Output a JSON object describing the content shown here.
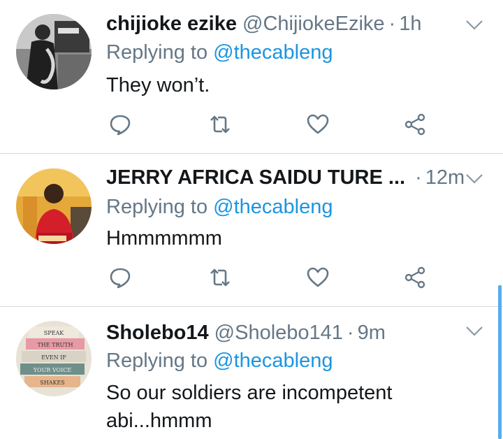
{
  "tweets": [
    {
      "name": "chijioke ezike",
      "handle": "@ChijiokeEzike",
      "separator": "·",
      "time": "1h",
      "replying_prefix": "Replying to",
      "replying_to": "@thecableng",
      "text": "They won’t."
    },
    {
      "name": "JERRY AFRICA SAIDU TURE ...",
      "handle": "",
      "separator": "·",
      "time": "12m",
      "replying_prefix": "Replying to",
      "replying_to": "@thecableng",
      "text": "Hmmmmmm"
    },
    {
      "name": "Sholebo14",
      "handle": "@Sholebo141",
      "separator": "·",
      "time": "9m",
      "replying_prefix": "Replying to",
      "replying_to": "@thecableng",
      "text_line1": "So our soldiers are incompetent",
      "text_line2": "abi...hmmm",
      "avatar_text": [
        "SPEAK",
        "THE TRUTH",
        "EVEN IF",
        "YOUR VOICE",
        "SHAKES"
      ]
    }
  ],
  "icons": {
    "reply": "reply-icon",
    "retweet": "retweet-icon",
    "like": "heart-icon",
    "share": "share-icon",
    "more": "chevron-down-icon"
  },
  "colors": {
    "text": "#14171a",
    "secondary": "#657786",
    "link": "#1b95e0",
    "divider": "#d5dade"
  }
}
